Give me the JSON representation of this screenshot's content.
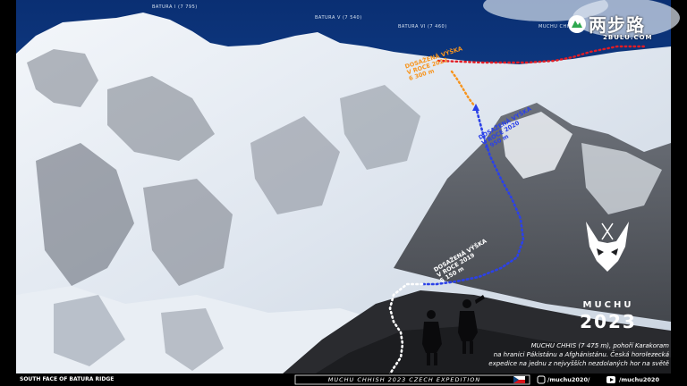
{
  "peaks": {
    "batura1": "BATURA I (7 795)",
    "batura5": "BATURA V (7 540)",
    "batura6": "BATURA VI (7 460)",
    "muchu": "MUCHU CHHISH"
  },
  "routes": {
    "orange_line1": "DOSAŽENÁ VÝŠKA",
    "orange_line2": "V ROCE 2022",
    "orange_line3": "6 300 m",
    "blue_line1": "DOSAŽENÁ VÝŠKA",
    "blue_line2": "V ROCE 2020",
    "blue_line3": "5 950 m",
    "white_line1": "DOSAŽENÁ VÝŠKA",
    "white_line2": "V ROCE 2019",
    "white_line3": "5 150 m"
  },
  "logo": {
    "name": "MUCHU",
    "year": "2023"
  },
  "caption": {
    "line1": "MUCHU CHHIS (7 475 m), pohoří Karakoram",
    "line2": "na hranici Pákistánu a Afghánistánu. Česká horolezecká",
    "line3": "expedice na jednu z nejvyšších nezdolaných hor na světě"
  },
  "bottom": {
    "left": "SOUTH FACE OF BATURA RIDGE",
    "expedition": "MUCHU CHHISH 2023 CZECH EXPEDITION",
    "social1": "/muchu2020/",
    "social2": "/muchu2020"
  },
  "watermark": {
    "cn": "两步路",
    "url": "2BULU.COM"
  },
  "colors": {
    "sky": "#0b3a86",
    "orange_route": "#f7941d",
    "blue_route": "#2b41e8",
    "red_route": "#e21b24"
  }
}
